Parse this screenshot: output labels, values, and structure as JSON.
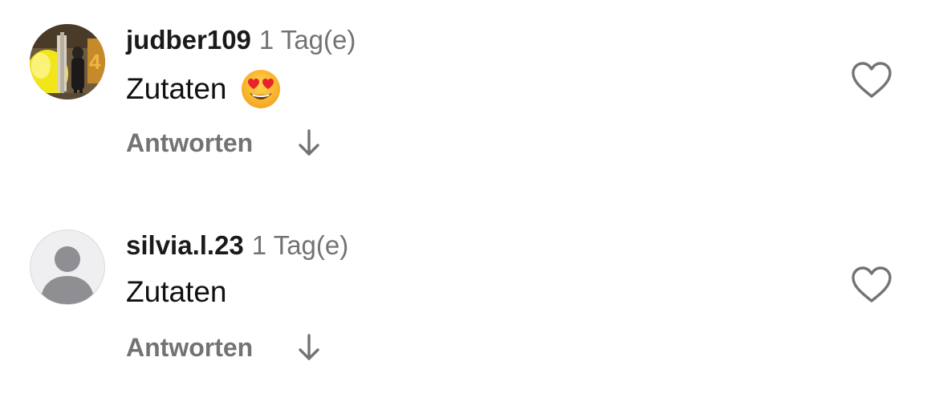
{
  "comments": [
    {
      "username": "judber109",
      "time": "1 Tag(e)",
      "text": "Zutaten",
      "emoji": "smiling-face-with-heart-eyes",
      "reply_label": "Antworten",
      "avatar": "photo"
    },
    {
      "username": "silvia.l.23",
      "time": "1 Tag(e)",
      "text": "Zutaten",
      "reply_label": "Antworten",
      "avatar": "default-silhouette"
    }
  ],
  "colors": {
    "secondary_text": "#737373",
    "primary_text": "#111111",
    "default_avatar_bg": "#efeff1",
    "default_avatar_fg": "#8e8e93"
  },
  "icons": {
    "like": "heart-outline-icon",
    "expand": "arrow-down-icon"
  }
}
